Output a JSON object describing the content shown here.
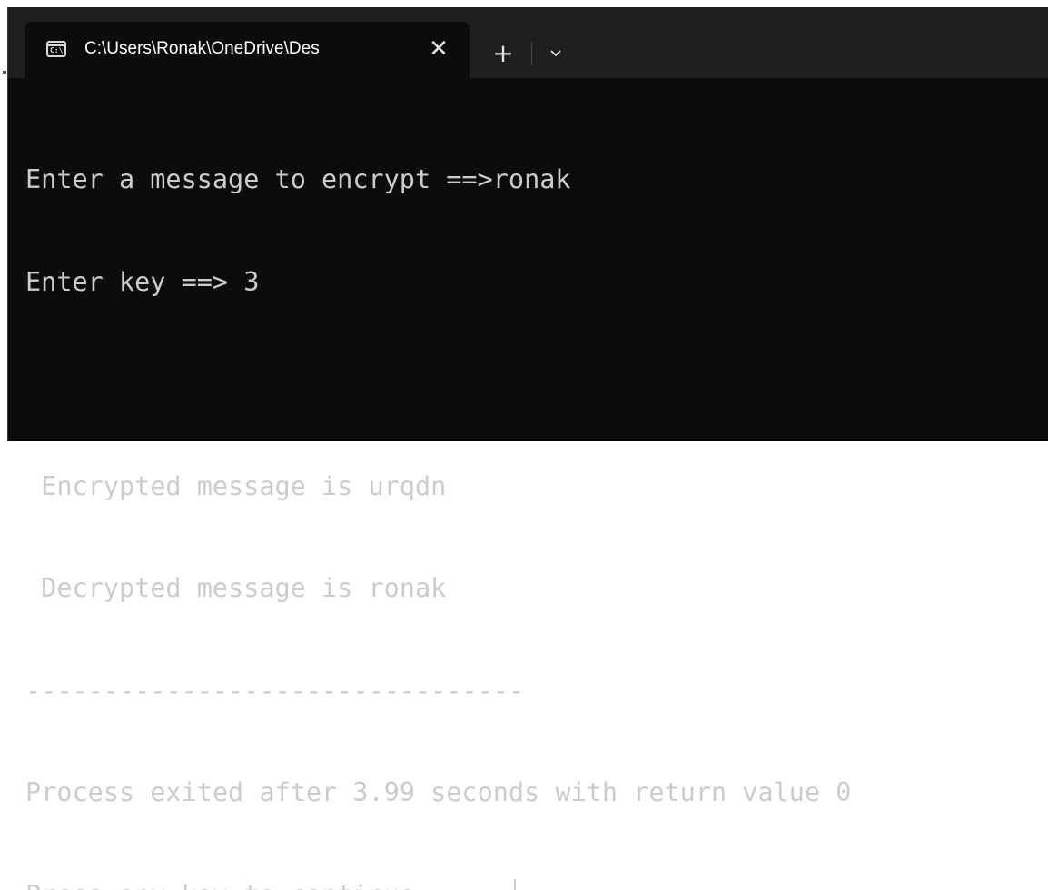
{
  "window": {
    "tab_title": "C:\\Users\\Ronak\\OneDrive\\Des",
    "tab_icon": "console-icon",
    "tab_icon_glyph": "C:\\",
    "close_glyph": "✕",
    "new_tab_glyph": "+",
    "dropdown_icon": "chevron-down-icon"
  },
  "console": {
    "lines": [
      "Enter a message to encrypt ==>ronak",
      "Enter key ==> 3",
      "",
      " Encrypted message is urqdn",
      " Decrypted message is ronak",
      "--------------------------------",
      "Process exited after 3.99 seconds with return value 0",
      "Press any key to continue . . ."
    ]
  },
  "colors": {
    "console_background": "#0c0c0c",
    "titlebar_background": "#1f1f1f",
    "text": "#cccccc"
  }
}
